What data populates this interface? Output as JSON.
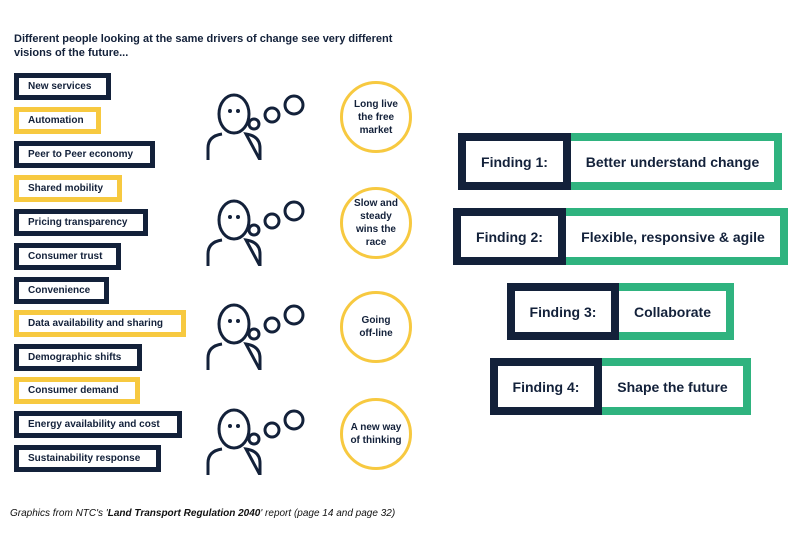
{
  "intro": "Different people looking at the same drivers of change see very different visions of the future...",
  "drivers": [
    {
      "label": "New services",
      "highlight": false
    },
    {
      "label": "Automation",
      "highlight": true
    },
    {
      "label": "Peer to Peer economy",
      "highlight": false
    },
    {
      "label": "Shared mobility",
      "highlight": true
    },
    {
      "label": "Pricing transparency",
      "highlight": false
    },
    {
      "label": "Consumer trust",
      "highlight": false
    },
    {
      "label": "Convenience",
      "highlight": false
    },
    {
      "label": "Data availability and sharing",
      "highlight": true
    },
    {
      "label": "Demographic shifts",
      "highlight": false
    },
    {
      "label": "Consumer demand",
      "highlight": true
    },
    {
      "label": "Energy availability and cost",
      "highlight": false
    },
    {
      "label": "Sustainability response",
      "highlight": false
    }
  ],
  "visions": [
    {
      "thought": "Long live the free market"
    },
    {
      "thought": "Slow and steady wins the race"
    },
    {
      "thought": "Going off-line"
    },
    {
      "thought": "A new way of thinking"
    }
  ],
  "findings": [
    {
      "label": "Finding 1:",
      "text": "Better understand change"
    },
    {
      "label": "Finding 2:",
      "text": "Flexible, responsive & agile"
    },
    {
      "label": "Finding 3:",
      "text": "Collaborate"
    },
    {
      "label": "Finding 4:",
      "text": "Shape the future"
    }
  ],
  "caption": {
    "prefix": "Graphics from NTC's '",
    "title": "Land Transport Regulation 2040",
    "suffix": "' report (page 14 and page 32)"
  },
  "colors": {
    "navy": "#13213a",
    "yellow": "#f7c940",
    "green": "#2fb37f"
  }
}
